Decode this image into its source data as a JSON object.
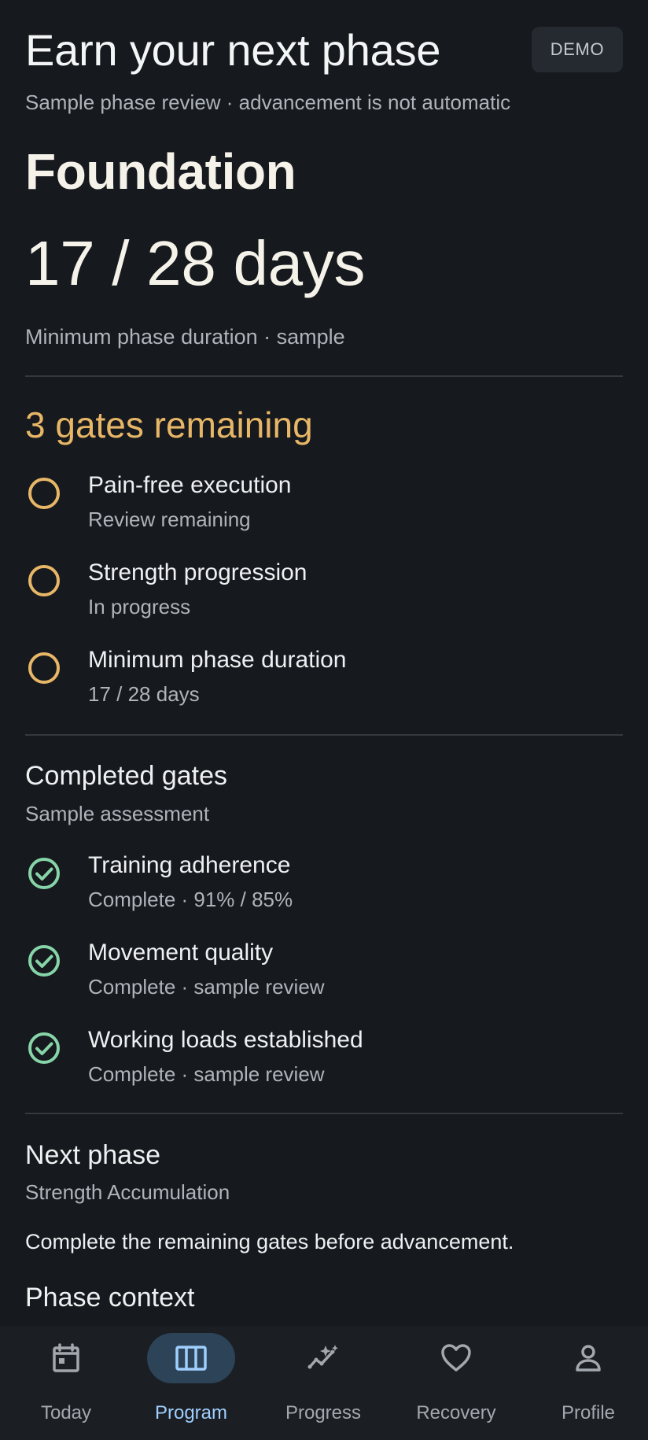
{
  "header": {
    "title": "Earn your next phase",
    "badge": "DEMO",
    "subtitle": "Sample phase review · advancement is not automatic"
  },
  "phase": {
    "name": "Foundation",
    "days_display": "17 / 28 days",
    "duration_note": "Minimum phase duration · sample"
  },
  "remaining_gates": {
    "title": "3 gates remaining",
    "items": [
      {
        "label": "Pain-free execution",
        "status": "Review remaining",
        "icon": "empty-circle-icon"
      },
      {
        "label": "Strength progression",
        "status": "In progress",
        "icon": "empty-circle-icon"
      },
      {
        "label": "Minimum phase duration",
        "status": "17 / 28 days",
        "icon": "empty-circle-icon"
      }
    ]
  },
  "completed_gates": {
    "title": "Completed gates",
    "subtitle": "Sample assessment",
    "items": [
      {
        "label": "Training adherence",
        "status": "Complete · 91% / 85%",
        "icon": "check-circle-icon"
      },
      {
        "label": "Movement quality",
        "status": "Complete · sample review",
        "icon": "check-circle-icon"
      },
      {
        "label": "Working loads established",
        "status": "Complete · sample review",
        "icon": "check-circle-icon"
      }
    ]
  },
  "next_phase": {
    "title": "Next phase",
    "name": "Strength Accumulation",
    "note": "Complete the remaining gates before advancement."
  },
  "phase_context": {
    "title": "Phase context"
  },
  "navigation": {
    "items": [
      {
        "label": "Today",
        "icon": "calendar-icon"
      },
      {
        "label": "Program",
        "icon": "columns-icon",
        "active": true
      },
      {
        "label": "Progress",
        "icon": "trend-sparkle-icon"
      },
      {
        "label": "Recovery",
        "icon": "heart-icon"
      },
      {
        "label": "Profile",
        "icon": "person-icon"
      }
    ]
  },
  "colors": {
    "background": "#16191d",
    "text": "#eef0f2",
    "muted_text": "#aeb4bb",
    "pending_accent": "#e7b667",
    "complete_accent": "#86d4a8",
    "active_nav": "#9fcfff",
    "active_nav_fill": "#2d4357"
  }
}
